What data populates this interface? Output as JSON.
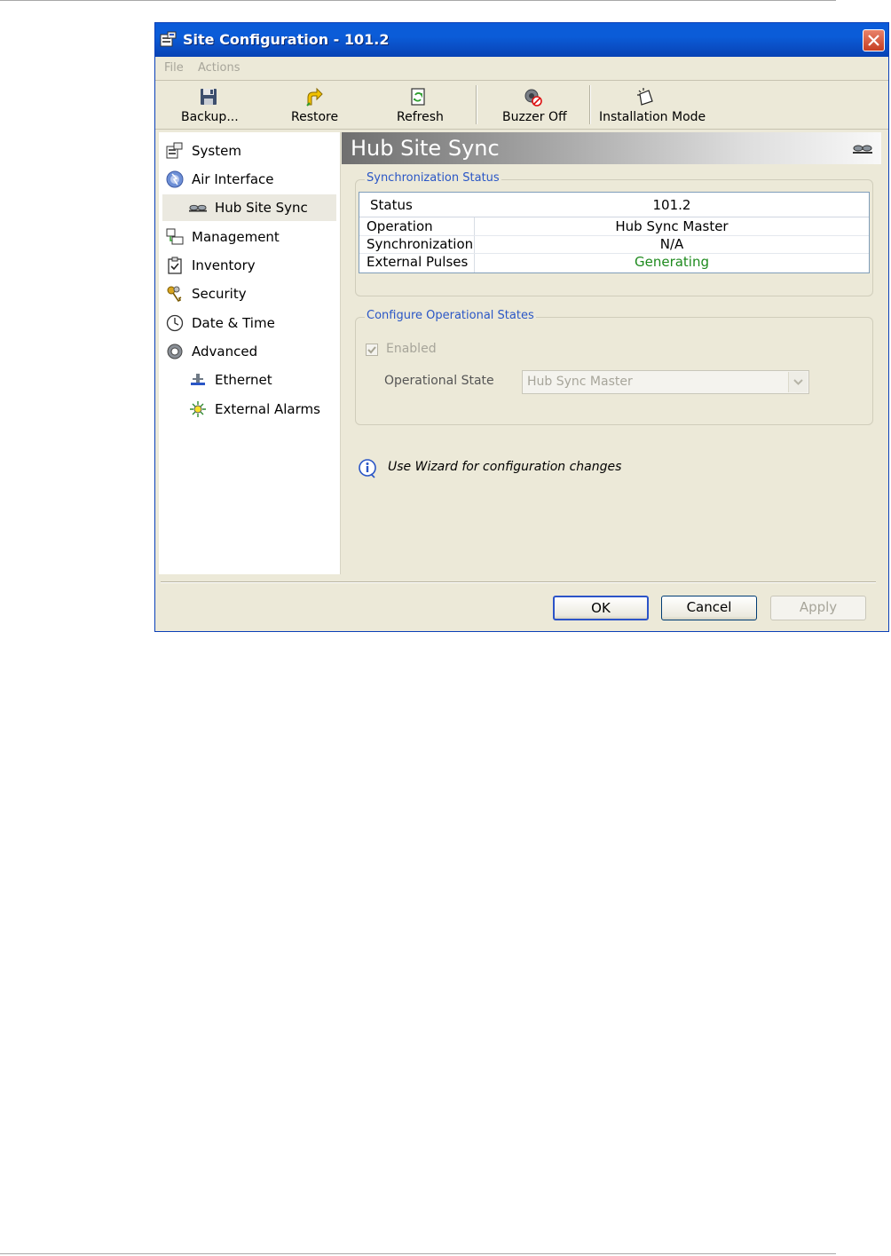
{
  "window": {
    "title": "Site Configuration - 101.2"
  },
  "menu": {
    "items": [
      "File",
      "Actions"
    ]
  },
  "toolbar": {
    "buttons": [
      {
        "label": "Backup...",
        "icon": "floppy-disk-icon"
      },
      {
        "label": "Restore",
        "icon": "restore-arrow-icon"
      },
      {
        "label": "Refresh",
        "icon": "refresh-icon"
      },
      {
        "label": "Buzzer Off",
        "icon": "buzzer-off-icon"
      },
      {
        "label": "Installation Mode",
        "icon": "installation-mode-icon"
      }
    ]
  },
  "sidebar": {
    "selected": "Hub Site Sync",
    "items": [
      {
        "label": "System",
        "icon": "system-icon"
      },
      {
        "label": "Air Interface",
        "icon": "air-interface-icon"
      },
      {
        "label": "Hub Site Sync",
        "icon": "hub-sync-icon"
      },
      {
        "label": "Management",
        "icon": "management-icon"
      },
      {
        "label": "Inventory",
        "icon": "inventory-icon"
      },
      {
        "label": "Security",
        "icon": "security-keys-icon"
      },
      {
        "label": "Date & Time",
        "icon": "clock-icon"
      },
      {
        "label": "Advanced",
        "icon": "gear-icon"
      },
      {
        "label": "Ethernet",
        "icon": "ethernet-icon"
      },
      {
        "label": "External Alarms",
        "icon": "alarm-icon"
      }
    ]
  },
  "content": {
    "title": "Hub Site Sync",
    "sync_status": {
      "legend": "Synchronization Status",
      "header": {
        "key": "Status",
        "value": "101.2"
      },
      "rows": [
        {
          "key": "Operation",
          "value": "Hub Sync Master"
        },
        {
          "key": "Synchronization",
          "value": "N/A"
        },
        {
          "key": "External Pulses",
          "value": "Generating"
        }
      ],
      "generating_color": "#1e8a1e"
    },
    "operational": {
      "legend": "Configure Operational States",
      "enabled_label": "Enabled",
      "enabled_checked": true,
      "state_label": "Operational State",
      "state_value": "Hub Sync Master"
    },
    "info_text": "Use Wizard for configuration changes"
  },
  "buttons": {
    "ok": "OK",
    "cancel": "Cancel",
    "apply": "Apply"
  }
}
